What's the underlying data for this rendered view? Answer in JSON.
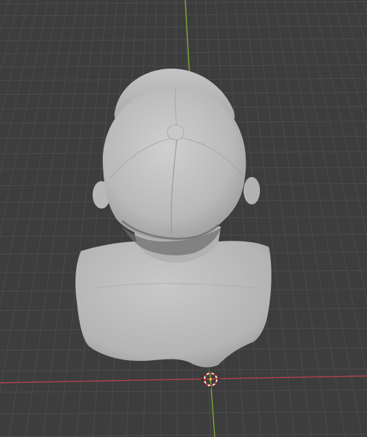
{
  "viewport": {
    "background_color": "#3d3d3d",
    "grid_color": "#4c4c4c",
    "grid_major_color": "#545454",
    "x_axis_color": "#b5414f",
    "y_axis_color": "#7fb033",
    "model_color": "#bfbfbf",
    "origin_icon": "3d-cursor-icon",
    "model_name": "bust-model"
  }
}
